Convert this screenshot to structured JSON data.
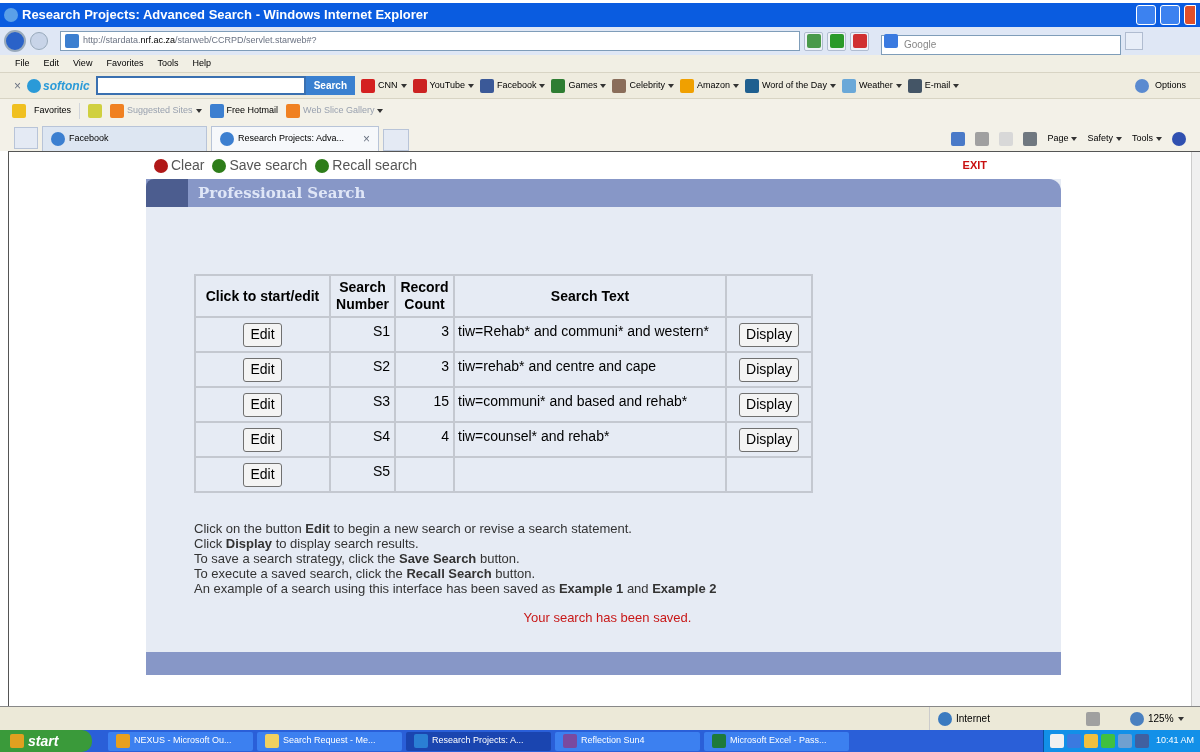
{
  "window": {
    "title": "Research Projects: Advanced Search - Windows Internet Explorer"
  },
  "address_bar": {
    "url_prefix": "http://stardata.",
    "url_domain": "nrf.ac.za",
    "url_path": "/starweb/CCRPD/servlet.starweb#?",
    "search_placeholder": "Google"
  },
  "menu": [
    "File",
    "Edit",
    "View",
    "Favorites",
    "Tools",
    "Help"
  ],
  "toolbar": {
    "close": "×",
    "brand": "softonic",
    "search_button": "Search",
    "links": [
      {
        "label": "CNN",
        "color": "#d42020"
      },
      {
        "label": "YouTube",
        "color": "#cc2222"
      },
      {
        "label": "Facebook",
        "color": "#3b5998"
      },
      {
        "label": "Games",
        "color": "#2e7d32"
      },
      {
        "label": "Celebrity",
        "color": "#8a6d5a"
      },
      {
        "label": "Amazon",
        "color": "#f0a000"
      },
      {
        "label": "Word of the Day",
        "color": "#1f5f8f"
      },
      {
        "label": "Weather",
        "color": "#6aa8d8"
      },
      {
        "label": "E-mail",
        "color": "#445566"
      }
    ],
    "options": "Options"
  },
  "favorites_bar": {
    "label": "Favorites",
    "items": [
      {
        "label": "Suggested Sites",
        "dim": true,
        "dropdown": true
      },
      {
        "label": "Free Hotmail",
        "dim": false,
        "dropdown": false
      },
      {
        "label": "Web Slice Gallery",
        "dim": true,
        "dropdown": true
      }
    ]
  },
  "tabs": [
    {
      "label": "Facebook",
      "selected": false
    },
    {
      "label": "Research Projects: Adva...",
      "selected": true,
      "close": "×"
    }
  ],
  "command_bar": [
    "Page",
    "Safety",
    "Tools"
  ],
  "page": {
    "actions": [
      {
        "label": "Clear",
        "color": "#b01818"
      },
      {
        "label": "Save search",
        "color": "#2e7d1a"
      },
      {
        "label": "Recall search",
        "color": "#2e7d1a"
      }
    ],
    "exit": "EXIT",
    "panel_title": "Professional Search",
    "table": {
      "columns": [
        "Click to start/edit",
        "Search Number",
        "Record Count",
        "Search Text"
      ],
      "rows": [
        {
          "edit": "Edit",
          "number": "S1",
          "count": "3",
          "text": "tiw=Rehab* and communi* and western*",
          "display": "Display"
        },
        {
          "edit": "Edit",
          "number": "S2",
          "count": "3",
          "text": "tiw=rehab* and centre and cape",
          "display": "Display"
        },
        {
          "edit": "Edit",
          "number": "S3",
          "count": "15",
          "text": "tiw=communi* and based and rehab*",
          "display": "Display"
        },
        {
          "edit": "Edit",
          "number": "S4",
          "count": "4",
          "text": "tiw=counsel* and rehab*",
          "display": "Display"
        },
        {
          "edit": "Edit",
          "number": "S5"
        }
      ]
    },
    "instructions": [
      "Click on the button **Edit** to begin a new search or revise a search statement.",
      "Click **Display** to display search results.",
      "To save a search strategy, click the **Save Search** button.",
      "To execute a saved search, click the **Recall Search** button.",
      "An example of a search using this interface has been saved as **Example 1** and **Example 2**"
    ],
    "message": "Your search has been saved."
  },
  "status_bar": {
    "zone": "Internet",
    "zoom": "125%"
  },
  "taskbar": {
    "start": "start",
    "items": [
      {
        "label": "NEXUS - Microsoft Ou...",
        "selected": false,
        "color": "#e8a020"
      },
      {
        "label": "Search Request - Me...",
        "selected": false,
        "color": "#f0d060"
      },
      {
        "label": "Research Projects: A...",
        "selected": true,
        "color": "#2a7fd4"
      },
      {
        "label": "Reflection Sun4",
        "selected": false,
        "color": "#7a4aa0"
      },
      {
        "label": "Microsoft Excel - Pass...",
        "selected": false,
        "color": "#1e7a3a"
      }
    ],
    "clock": "10:41 AM"
  }
}
